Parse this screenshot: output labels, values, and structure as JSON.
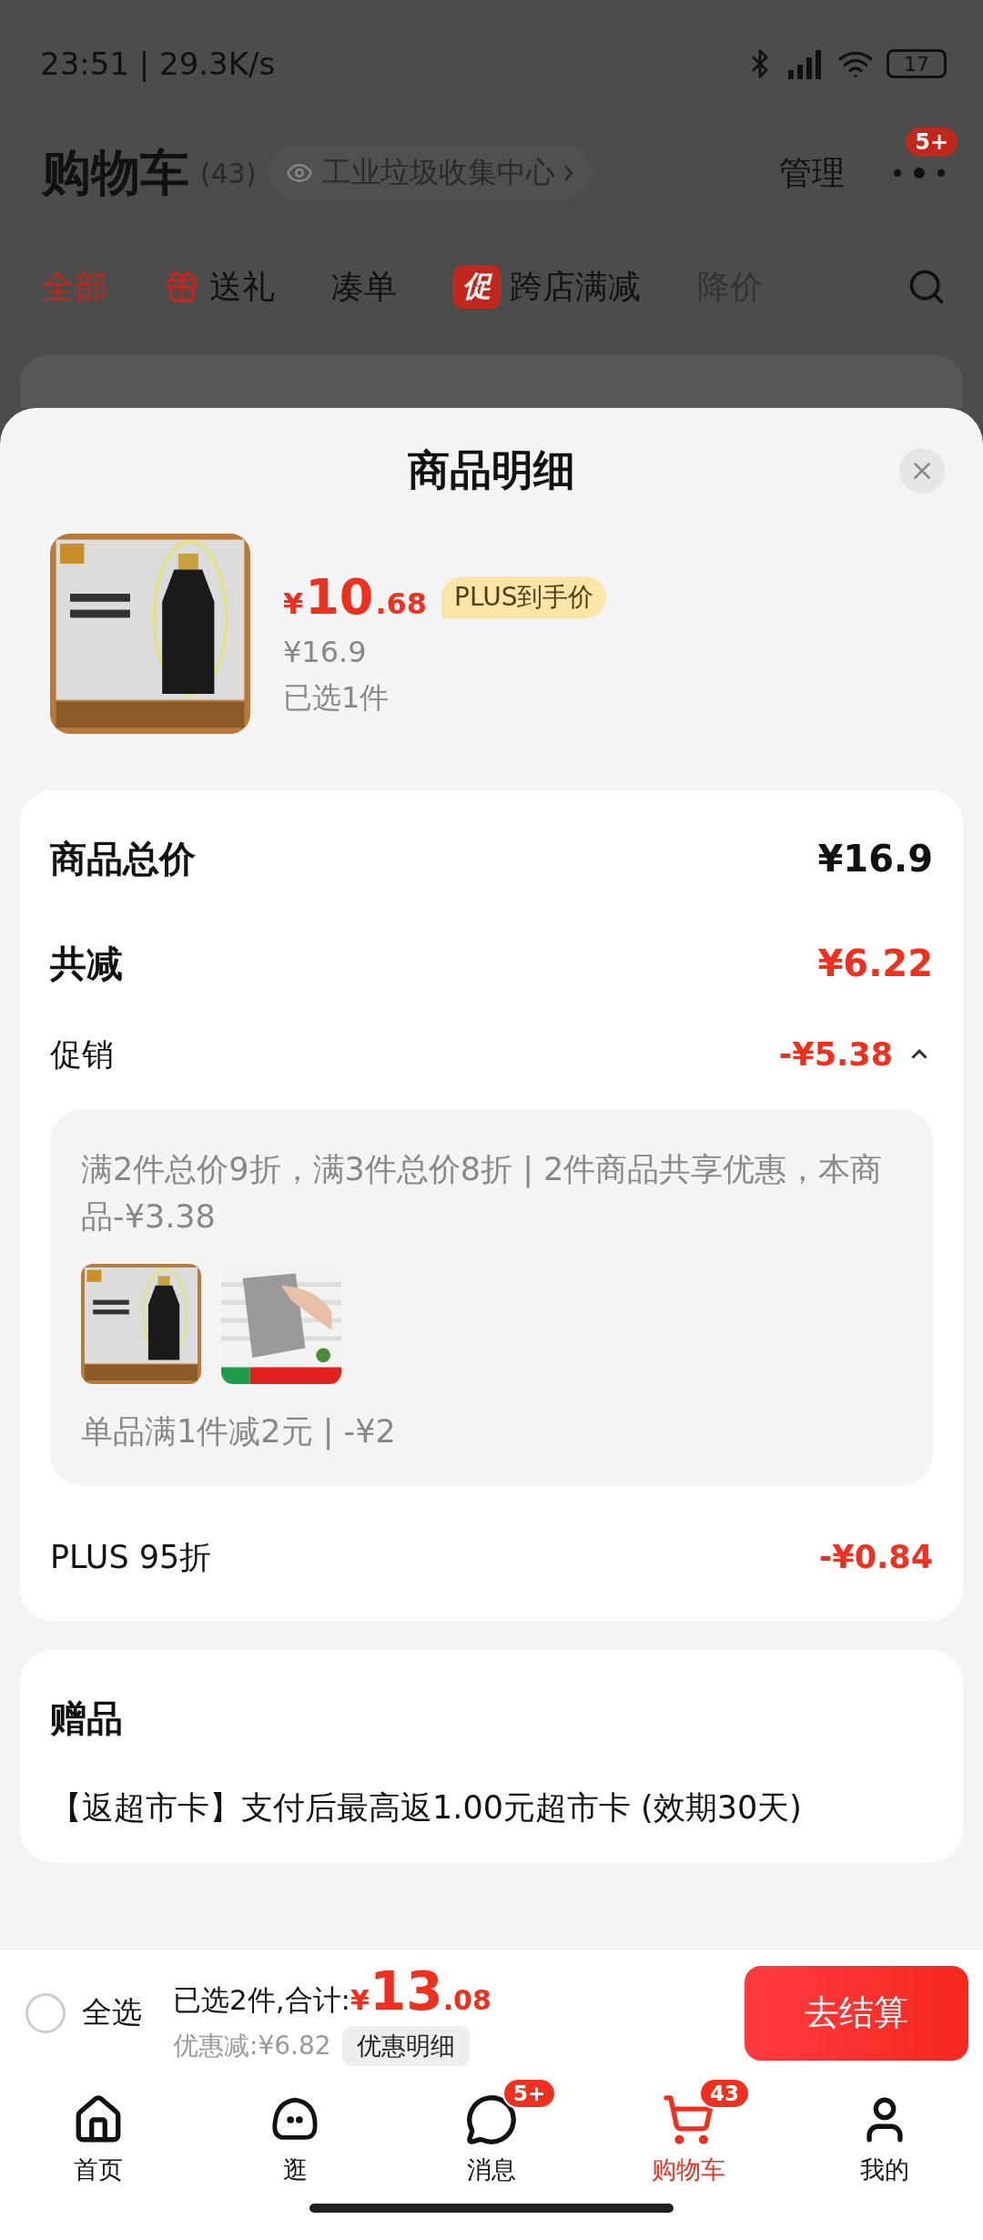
{
  "status_bar": {
    "time": "23:51 | 29.3K/s",
    "battery": "17"
  },
  "header": {
    "title": "购物车",
    "count": "(43)",
    "chip": "工业垃圾收集中心",
    "manage": "管理",
    "more_badge": "5+"
  },
  "filter_tabs": [
    {
      "label": "全部",
      "selected": true,
      "disabled": false,
      "kind": "plain"
    },
    {
      "label": "送礼",
      "selected": false,
      "disabled": false,
      "kind": "gift"
    },
    {
      "label": "凑单",
      "selected": false,
      "disabled": false,
      "kind": "plain"
    },
    {
      "label": "跨店满减",
      "selected": false,
      "disabled": false,
      "kind": "promo",
      "tag": "促"
    },
    {
      "label": "降价",
      "selected": false,
      "disabled": true,
      "kind": "plain"
    }
  ],
  "sheet": {
    "title": "商品明细",
    "product": {
      "currency": "¥",
      "price_int": "10",
      "price_dec": ".68",
      "tag": "PLUS到手价",
      "original_price": "¥16.9",
      "selected_count": "已选1件"
    },
    "total": {
      "label": "商品总价",
      "value": "¥16.9"
    },
    "reduction": {
      "label": "共减",
      "value": "¥6.22"
    },
    "promotion": {
      "label": "促销",
      "value": "-¥5.38",
      "expanded": true,
      "details": [
        {
          "text": "满2件总价9折，满3件总价8折 | 2件商品共享优惠，本商品-¥3.38"
        },
        {
          "text": "单品满1件减2元 | -¥2"
        }
      ]
    },
    "plus": {
      "label": "PLUS 95折",
      "value": "-¥0.84"
    },
    "gift": {
      "title": "赠品",
      "text": "【返超市卡】支付后最高返1.00元超市卡 (效期30天)"
    }
  },
  "checkout": {
    "select_all": {
      "label": "全选",
      "checked": false
    },
    "summary": "已选2件,合计:",
    "currency": "¥",
    "total_int": "13",
    "total_dec": ".08",
    "discount": "优惠减:¥6.82",
    "detail_button": "优惠明细",
    "button": "去结算"
  },
  "nav": [
    {
      "label": "首页",
      "selected": false,
      "kind": "home"
    },
    {
      "label": "逛",
      "selected": false,
      "kind": "stroll"
    },
    {
      "label": "消息",
      "selected": false,
      "kind": "message",
      "badge": "5+"
    },
    {
      "label": "购物车",
      "selected": true,
      "kind": "cart",
      "badge": "43"
    },
    {
      "label": "我的",
      "selected": false,
      "kind": "me"
    }
  ]
}
